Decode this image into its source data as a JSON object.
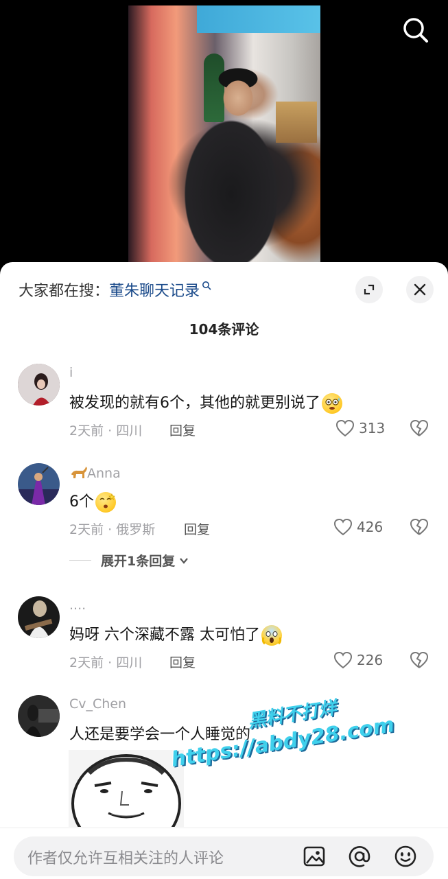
{
  "header": {
    "hot_search_prefix": "大家都在搜：",
    "hot_search_keyword": "董朱聊天记录"
  },
  "comments_count": "104条评论",
  "comments": [
    {
      "username": "i",
      "text": "被发现的就有6个，其他的就更别说了",
      "emoji": "sweat-smile-emoji",
      "time_location": "2天前 · 四川",
      "reply_label": "回复",
      "likes": "313"
    },
    {
      "username": "Anna",
      "username_emoji": "dog-emoji",
      "text": "6个",
      "emoji": "dizzy-face-emoji",
      "time_location": "2天前 · 俄罗斯",
      "reply_label": "回复",
      "likes": "426",
      "expand_replies": "展开1条回复"
    },
    {
      "username": "....",
      "text": "妈呀 六个深藏不露 太可怕了",
      "emoji": "scream-emoji",
      "time_location": "2天前 · 四川",
      "reply_label": "回复",
      "likes": "226"
    },
    {
      "username": "Cv_Chen",
      "text": "人还是要学会一个人睡觉的",
      "has_sticker": true
    }
  ],
  "watermark": {
    "line1": "黑料不打烊",
    "line2": "https://abdy28.com"
  },
  "bottom_bar": {
    "placeholder": "作者仅允许互相关注的人评论"
  },
  "colors": {
    "keyword": "#1a4a8a",
    "muted": "#a0a0a4",
    "background_sheet": "#ffffff"
  }
}
